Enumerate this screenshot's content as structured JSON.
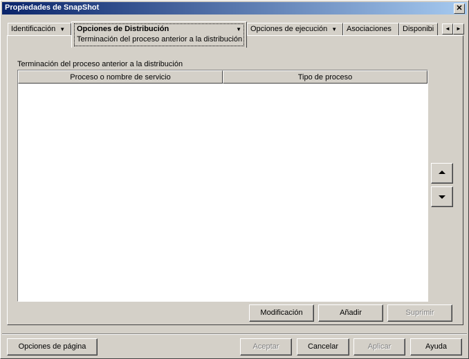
{
  "window": {
    "title": "Propiedades de SnapShot",
    "close_label": "✕"
  },
  "tabs": [
    {
      "label": "Identificación",
      "has_dropdown": true
    },
    {
      "label": "Opciones de Distribución",
      "subtab": "Terminación del proceso anterior a la distribución",
      "has_dropdown": true,
      "active": true
    },
    {
      "label": "Opciones de ejecución",
      "has_dropdown": true
    },
    {
      "label": "Asociaciones"
    },
    {
      "label": "Disponibi"
    }
  ],
  "tab_scroll": {
    "left": "◄",
    "right": "►"
  },
  "list": {
    "label": "Terminación del proceso anterior a la distribución",
    "columns": [
      "Proceso o nombre de servicio",
      "Tipo de proceso"
    ],
    "rows": []
  },
  "side_buttons": {
    "up_icon": "up-arrow-icon",
    "down_icon": "down-arrow-icon"
  },
  "list_buttons": {
    "modify": "Modificación",
    "add": "Añadir",
    "delete": "Suprimir"
  },
  "footer": {
    "page_options": "Opciones de página",
    "accept": "Aceptar",
    "cancel": "Cancelar",
    "apply": "Aplicar",
    "help": "Ayuda"
  },
  "dropdown_arrow": "▼"
}
